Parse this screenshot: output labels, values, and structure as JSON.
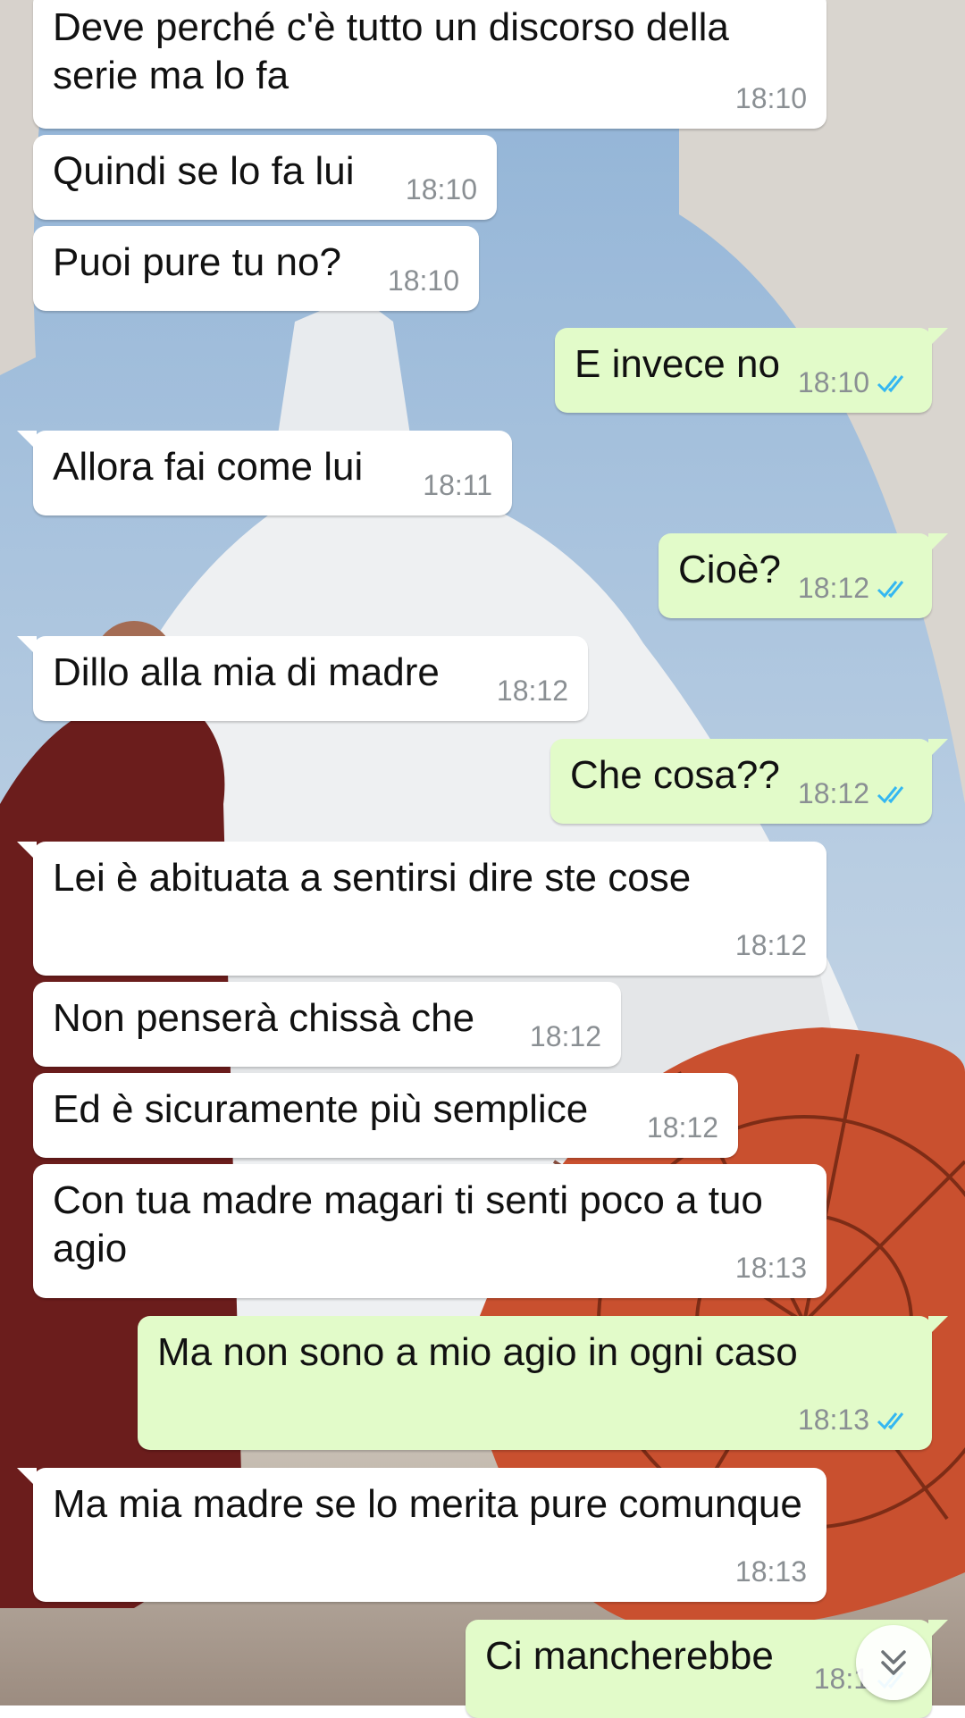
{
  "colors": {
    "incoming_bubble": "#ffffff",
    "outgoing_bubble": "#e2fbc9",
    "timestamp": "#8a8f93",
    "read_ticks": "#34b7f1"
  },
  "messages": [
    {
      "direction": "in",
      "text": "Deve perché c'è tutto un discorso della serie ma lo fa",
      "time": "18:10"
    },
    {
      "direction": "in",
      "text": "Quindi se lo fa lui",
      "time": "18:10"
    },
    {
      "direction": "in",
      "text": "Puoi pure tu no?",
      "time": "18:10"
    },
    {
      "direction": "out",
      "text": "E invece no",
      "time": "18:10",
      "status_icon": "double-check-icon"
    },
    {
      "direction": "in",
      "text": "Allora fai come lui",
      "time": "18:11"
    },
    {
      "direction": "out",
      "text": "Cioè?",
      "time": "18:12",
      "status_icon": "double-check-icon"
    },
    {
      "direction": "in",
      "text": "Dillo alla mia di madre",
      "time": "18:12"
    },
    {
      "direction": "out",
      "text": "Che cosa??",
      "time": "18:12",
      "status_icon": "double-check-icon"
    },
    {
      "direction": "in",
      "text": "Lei è abituata a sentirsi dire ste cose",
      "time": "18:12"
    },
    {
      "direction": "in",
      "text": "Non penserà chissà che",
      "time": "18:12"
    },
    {
      "direction": "in",
      "text": "Ed è sicuramente più semplice",
      "time": "18:12"
    },
    {
      "direction": "in",
      "text": "Con tua madre magari ti senti poco a tuo agio",
      "time": "18:13"
    },
    {
      "direction": "out",
      "text": "Ma non sono a mio agio in ogni caso",
      "time": "18:13",
      "status_icon": "double-check-icon"
    },
    {
      "direction": "in",
      "text": "Ma mia madre se lo merita pure comunque",
      "time": "18:13"
    },
    {
      "direction": "out",
      "text": "Ci mancherebbe",
      "time": "18:1",
      "status_icon": "double-check-icon"
    }
  ],
  "scroll_down_icon": "double-chevron-down-icon"
}
